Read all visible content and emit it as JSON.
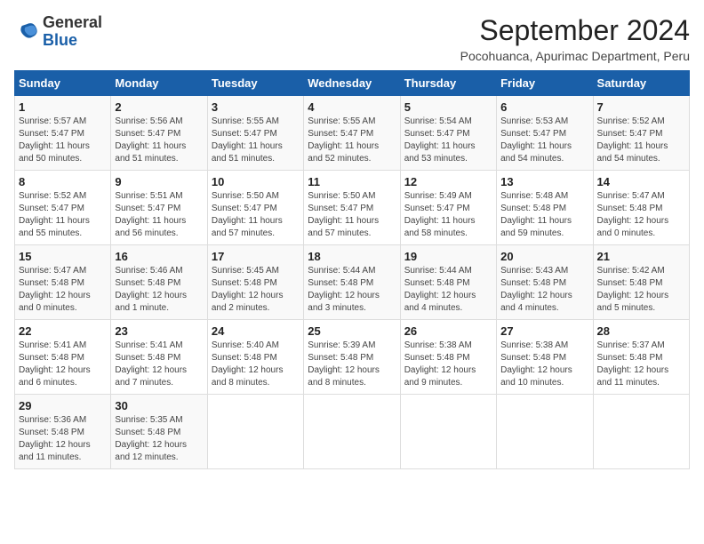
{
  "logo": {
    "line1": "General",
    "line2": "Blue"
  },
  "title": "September 2024",
  "subtitle": "Pocohuanca, Apurimac Department, Peru",
  "days_of_week": [
    "Sunday",
    "Monday",
    "Tuesday",
    "Wednesday",
    "Thursday",
    "Friday",
    "Saturday"
  ],
  "weeks": [
    [
      {
        "day": "1",
        "info": "Sunrise: 5:57 AM\nSunset: 5:47 PM\nDaylight: 11 hours\nand 50 minutes."
      },
      {
        "day": "2",
        "info": "Sunrise: 5:56 AM\nSunset: 5:47 PM\nDaylight: 11 hours\nand 51 minutes."
      },
      {
        "day": "3",
        "info": "Sunrise: 5:55 AM\nSunset: 5:47 PM\nDaylight: 11 hours\nand 51 minutes."
      },
      {
        "day": "4",
        "info": "Sunrise: 5:55 AM\nSunset: 5:47 PM\nDaylight: 11 hours\nand 52 minutes."
      },
      {
        "day": "5",
        "info": "Sunrise: 5:54 AM\nSunset: 5:47 PM\nDaylight: 11 hours\nand 53 minutes."
      },
      {
        "day": "6",
        "info": "Sunrise: 5:53 AM\nSunset: 5:47 PM\nDaylight: 11 hours\nand 54 minutes."
      },
      {
        "day": "7",
        "info": "Sunrise: 5:52 AM\nSunset: 5:47 PM\nDaylight: 11 hours\nand 54 minutes."
      }
    ],
    [
      {
        "day": "8",
        "info": "Sunrise: 5:52 AM\nSunset: 5:47 PM\nDaylight: 11 hours\nand 55 minutes."
      },
      {
        "day": "9",
        "info": "Sunrise: 5:51 AM\nSunset: 5:47 PM\nDaylight: 11 hours\nand 56 minutes."
      },
      {
        "day": "10",
        "info": "Sunrise: 5:50 AM\nSunset: 5:47 PM\nDaylight: 11 hours\nand 57 minutes."
      },
      {
        "day": "11",
        "info": "Sunrise: 5:50 AM\nSunset: 5:47 PM\nDaylight: 11 hours\nand 57 minutes."
      },
      {
        "day": "12",
        "info": "Sunrise: 5:49 AM\nSunset: 5:47 PM\nDaylight: 11 hours\nand 58 minutes."
      },
      {
        "day": "13",
        "info": "Sunrise: 5:48 AM\nSunset: 5:48 PM\nDaylight: 11 hours\nand 59 minutes."
      },
      {
        "day": "14",
        "info": "Sunrise: 5:47 AM\nSunset: 5:48 PM\nDaylight: 12 hours\nand 0 minutes."
      }
    ],
    [
      {
        "day": "15",
        "info": "Sunrise: 5:47 AM\nSunset: 5:48 PM\nDaylight: 12 hours\nand 0 minutes."
      },
      {
        "day": "16",
        "info": "Sunrise: 5:46 AM\nSunset: 5:48 PM\nDaylight: 12 hours\nand 1 minute."
      },
      {
        "day": "17",
        "info": "Sunrise: 5:45 AM\nSunset: 5:48 PM\nDaylight: 12 hours\nand 2 minutes."
      },
      {
        "day": "18",
        "info": "Sunrise: 5:44 AM\nSunset: 5:48 PM\nDaylight: 12 hours\nand 3 minutes."
      },
      {
        "day": "19",
        "info": "Sunrise: 5:44 AM\nSunset: 5:48 PM\nDaylight: 12 hours\nand 4 minutes."
      },
      {
        "day": "20",
        "info": "Sunrise: 5:43 AM\nSunset: 5:48 PM\nDaylight: 12 hours\nand 4 minutes."
      },
      {
        "day": "21",
        "info": "Sunrise: 5:42 AM\nSunset: 5:48 PM\nDaylight: 12 hours\nand 5 minutes."
      }
    ],
    [
      {
        "day": "22",
        "info": "Sunrise: 5:41 AM\nSunset: 5:48 PM\nDaylight: 12 hours\nand 6 minutes."
      },
      {
        "day": "23",
        "info": "Sunrise: 5:41 AM\nSunset: 5:48 PM\nDaylight: 12 hours\nand 7 minutes."
      },
      {
        "day": "24",
        "info": "Sunrise: 5:40 AM\nSunset: 5:48 PM\nDaylight: 12 hours\nand 8 minutes."
      },
      {
        "day": "25",
        "info": "Sunrise: 5:39 AM\nSunset: 5:48 PM\nDaylight: 12 hours\nand 8 minutes."
      },
      {
        "day": "26",
        "info": "Sunrise: 5:38 AM\nSunset: 5:48 PM\nDaylight: 12 hours\nand 9 minutes."
      },
      {
        "day": "27",
        "info": "Sunrise: 5:38 AM\nSunset: 5:48 PM\nDaylight: 12 hours\nand 10 minutes."
      },
      {
        "day": "28",
        "info": "Sunrise: 5:37 AM\nSunset: 5:48 PM\nDaylight: 12 hours\nand 11 minutes."
      }
    ],
    [
      {
        "day": "29",
        "info": "Sunrise: 5:36 AM\nSunset: 5:48 PM\nDaylight: 12 hours\nand 11 minutes."
      },
      {
        "day": "30",
        "info": "Sunrise: 5:35 AM\nSunset: 5:48 PM\nDaylight: 12 hours\nand 12 minutes."
      },
      {
        "day": "",
        "info": ""
      },
      {
        "day": "",
        "info": ""
      },
      {
        "day": "",
        "info": ""
      },
      {
        "day": "",
        "info": ""
      },
      {
        "day": "",
        "info": ""
      }
    ]
  ]
}
